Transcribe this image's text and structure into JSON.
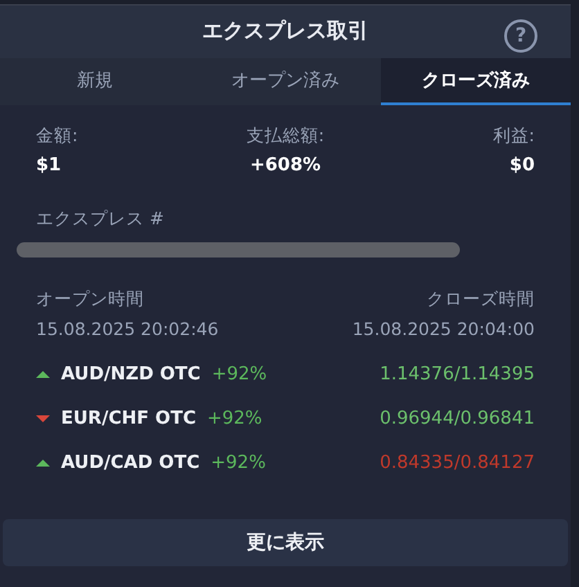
{
  "header": {
    "title": "エクスプレス取引",
    "help": "?"
  },
  "tabs": [
    {
      "label": "新規",
      "selected": false
    },
    {
      "label": "オープン済み",
      "selected": false
    },
    {
      "label": "クローズ済み",
      "selected": true
    }
  ],
  "summary": [
    {
      "label": "金額:",
      "value": "$1"
    },
    {
      "label": "支払総額:",
      "value": "+608%"
    },
    {
      "label": "利益:",
      "value": "$0"
    }
  ],
  "express": {
    "label": "エクスプレス #"
  },
  "times": {
    "open_label": "オープン時間",
    "open_value": "15.08.2025 20:02:46",
    "close_label": "クローズ時間",
    "close_value": "15.08.2025 20:04:00"
  },
  "trades": [
    {
      "rising": true,
      "pair": "AUD/NZD OTC",
      "payout": "+92%",
      "prices": "1.14376/1.14395",
      "won": true
    },
    {
      "rising": false,
      "pair": "EUR/CHF OTC",
      "payout": "+92%",
      "prices": "0.96944/0.96841",
      "won": true
    },
    {
      "rising": true,
      "pair": "AUD/CAD OTC",
      "payout": "+92%",
      "prices": "0.84335/0.84127",
      "won": false
    }
  ],
  "more_button": "更に表示"
}
